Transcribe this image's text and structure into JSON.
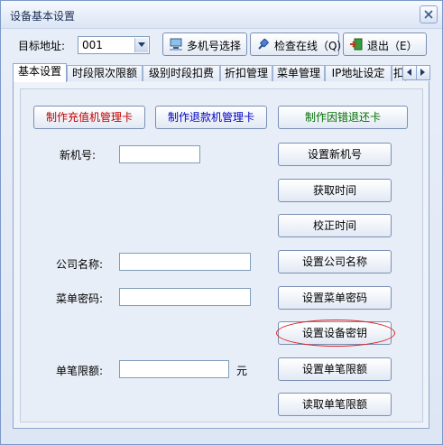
{
  "window": {
    "title": "设备基本设置"
  },
  "toolbar": {
    "address_label": "目标地址:",
    "address_value": "001",
    "multi_button": "多机号选择",
    "check_button": "检查在线（Q）",
    "exit_button": "退出（E）"
  },
  "tabs": [
    "基本设置",
    "时段限次限额",
    "级别时段扣费",
    "折扣管理",
    "菜单管理",
    "IP地址设定",
    "扣"
  ],
  "cards": {
    "recharge": "制作充值机管理卡",
    "refund": "制作退款机管理卡",
    "error_refund": "制作因错退还卡"
  },
  "fields": {
    "new_id_label": "新机号:",
    "company_label": "公司名称:",
    "menu_pwd_label": "菜单密码:",
    "single_limit_label": "单笔限额:",
    "unit": "元"
  },
  "actions": {
    "set_new_id": "设置新机号",
    "get_time": "获取时间",
    "calibrate_time": "校正时间",
    "set_company": "设置公司名称",
    "set_menu_pwd": "设置菜单密码",
    "set_device_key": "设置设备密钥",
    "set_single_limit": "设置单笔限额",
    "read_single_limit": "读取单笔限额"
  },
  "colors": {
    "recharge_text": "#c00000",
    "refund_text": "#0000c0",
    "error_refund_text": "#007000",
    "highlight": "#e02020"
  }
}
